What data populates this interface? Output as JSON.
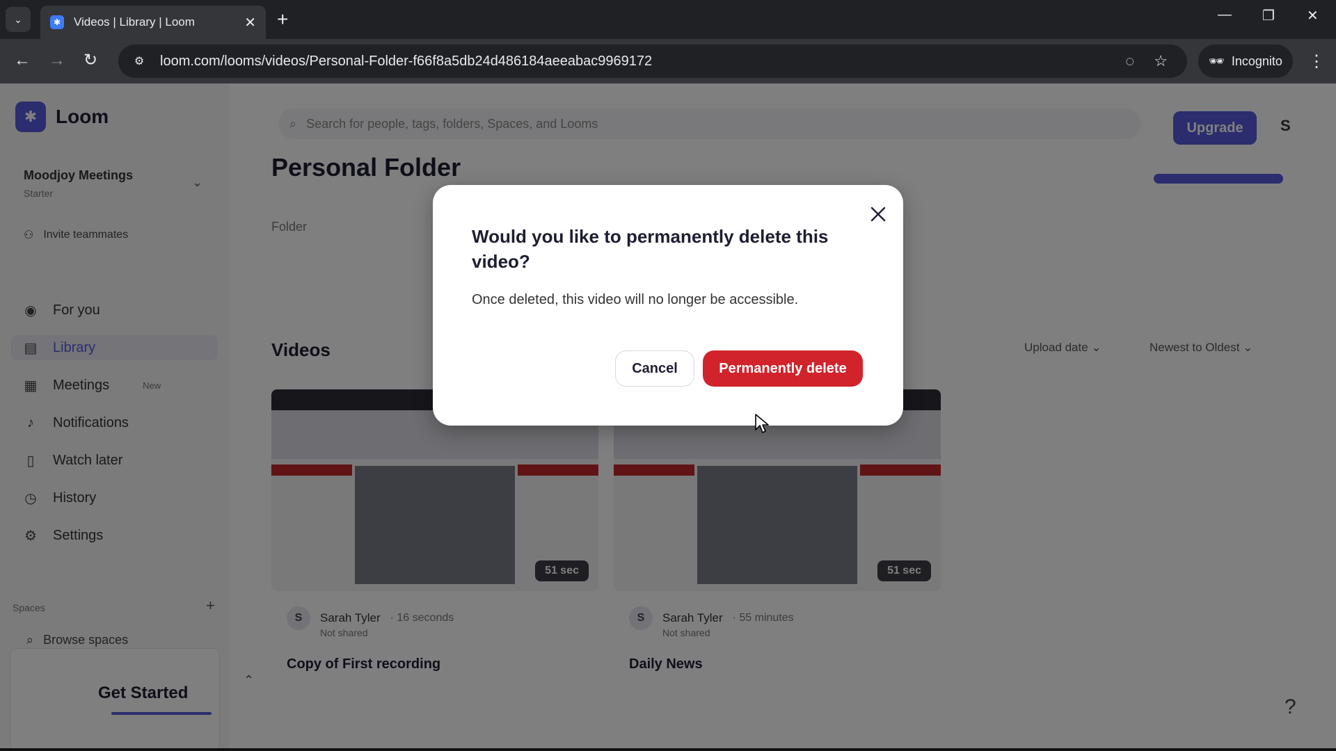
{
  "browser": {
    "tab_title": "Videos | Library | Loom",
    "url": "loom.com/looms/videos/Personal-Folder-f66f8a5db24d486184aeeabac9969172",
    "incognito_label": "Incognito"
  },
  "app": {
    "logo_text": "Loom",
    "workspace_name": "Moodjoy Meetings",
    "workspace_sub": "Starter",
    "invite_label": "Invite teammates",
    "nav": [
      {
        "label": "For you",
        "icon": "user-circle-icon"
      },
      {
        "label": "Library",
        "icon": "library-icon"
      },
      {
        "label": "Meetings",
        "icon": "calendar-icon",
        "badge": "New"
      },
      {
        "label": "Notifications",
        "icon": "bell-icon"
      },
      {
        "label": "Watch later",
        "icon": "bookmark-icon"
      },
      {
        "label": "History",
        "icon": "clock-icon"
      },
      {
        "label": "Settings",
        "icon": "gear-icon"
      }
    ],
    "spaces_label": "Spaces",
    "browse_spaces_label": "Browse spaces",
    "get_started_label": "Get Started",
    "search_placeholder": "Search for people, tags, folders, Spaces, and Looms",
    "upgrade_label": "Upgrade",
    "user_initial": "S",
    "folder_title": "Personal Folder",
    "folder_label": "Folder",
    "videos_heading": "Videos",
    "sort_by": "Upload date",
    "sort_order": "Newest to Oldest",
    "videos": [
      {
        "title": "Copy of First recording",
        "author": "Sarah Tyler",
        "time": "· 16 seconds",
        "shared": "Not shared",
        "duration": "51 sec",
        "initial": "S"
      },
      {
        "title": "Daily News",
        "author": "Sarah Tyler",
        "time": "· 55 minutes",
        "shared": "Not shared",
        "duration": "51 sec",
        "initial": "S"
      }
    ],
    "help_icon": "?"
  },
  "modal": {
    "title": "Would you like to permanently delete this video?",
    "body": "Once deleted, this video will no longer be accessible.",
    "cancel_label": "Cancel",
    "delete_label": "Permanently delete",
    "delete_color": "#d1232b"
  }
}
